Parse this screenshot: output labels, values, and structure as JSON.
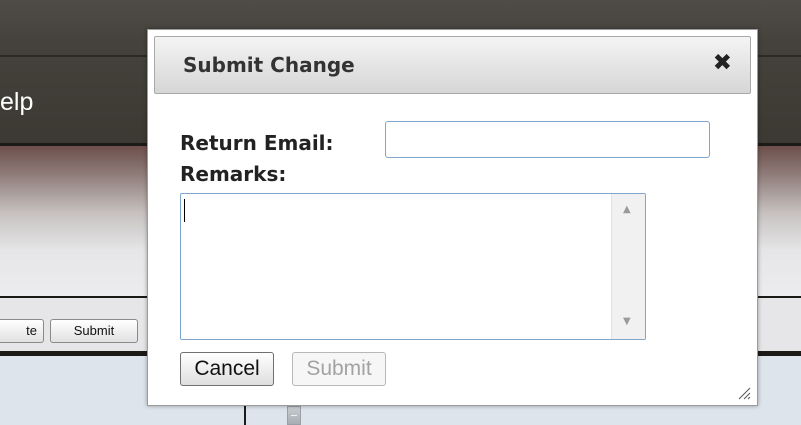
{
  "app": {
    "nav_help_label": "elp",
    "toolbar": {
      "partial_button_label": "te",
      "submit_button_label": "Submit"
    }
  },
  "dialog": {
    "title": "Submit Change",
    "close_glyph": "✖",
    "return_email_label": "Return Email:",
    "return_email_value": "",
    "remarks_label": "Remarks:",
    "remarks_value": "",
    "cancel_label": "Cancel",
    "submit_label": "Submit"
  },
  "icons": {
    "close": "close-icon",
    "scroll_up": "scroll-up-arrow-icon",
    "scroll_down": "scroll-down-arrow-icon",
    "resize": "resize-grip-icon"
  }
}
